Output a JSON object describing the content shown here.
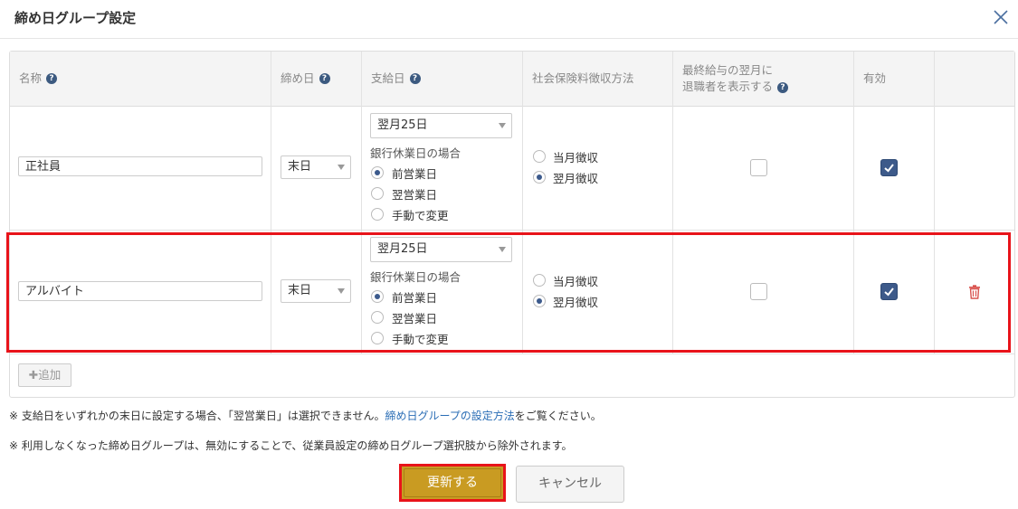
{
  "dialog": {
    "title": "締め日グループ設定",
    "close_icon": "close-icon"
  },
  "table": {
    "headers": {
      "name": "名称",
      "closing_day": "締め日",
      "pay_day": "支給日",
      "social_insurance": "社会保険料徴収方法",
      "last_salary_line1": "最終給与の翌月に",
      "last_salary_line2": "退職者を表示する",
      "enabled": "有効"
    },
    "help_icon": "question-circle-icon",
    "rows": [
      {
        "name": "正社員",
        "closing_day": "末日",
        "pay_day": "翌月25日",
        "holiday_label": "銀行休業日の場合",
        "holiday_options": [
          "前営業日",
          "翌営業日",
          "手動で変更"
        ],
        "holiday_selected": "前営業日",
        "insurance_options": [
          "当月徴収",
          "翌月徴収"
        ],
        "insurance_selected": "翌月徴収",
        "show_retired": false,
        "enabled": true
      },
      {
        "name": "アルバイト",
        "closing_day": "末日",
        "pay_day": "翌月25日",
        "holiday_label": "銀行休業日の場合",
        "holiday_options": [
          "前営業日",
          "翌営業日",
          "手動で変更"
        ],
        "holiday_selected": "前営業日",
        "insurance_options": [
          "当月徴収",
          "翌月徴収"
        ],
        "insurance_selected": "翌月徴収",
        "show_retired": false,
        "enabled": true,
        "delete_icon": "trash-icon"
      }
    ],
    "add_button": "✚追加"
  },
  "notes": {
    "note1_prefix": "※ 支給日をいずれかの末日に設定する場合、「翌営業日」は選択できません。",
    "note1_link": "締め日グループの設定方法",
    "note1_suffix": "をご覧ください。",
    "note2": "※ 利用しなくなった締め日グループは、無効にすることで、従業員設定の締め日グループ選択肢から除外されます。"
  },
  "footer": {
    "submit_label": "更新する",
    "cancel_label": "キャンセル"
  },
  "colors": {
    "primary": "#c99b22",
    "highlight": "#e8131a",
    "checkbox_on": "#3d5a8a",
    "link": "#2a6db5",
    "delete": "#d9534f"
  }
}
